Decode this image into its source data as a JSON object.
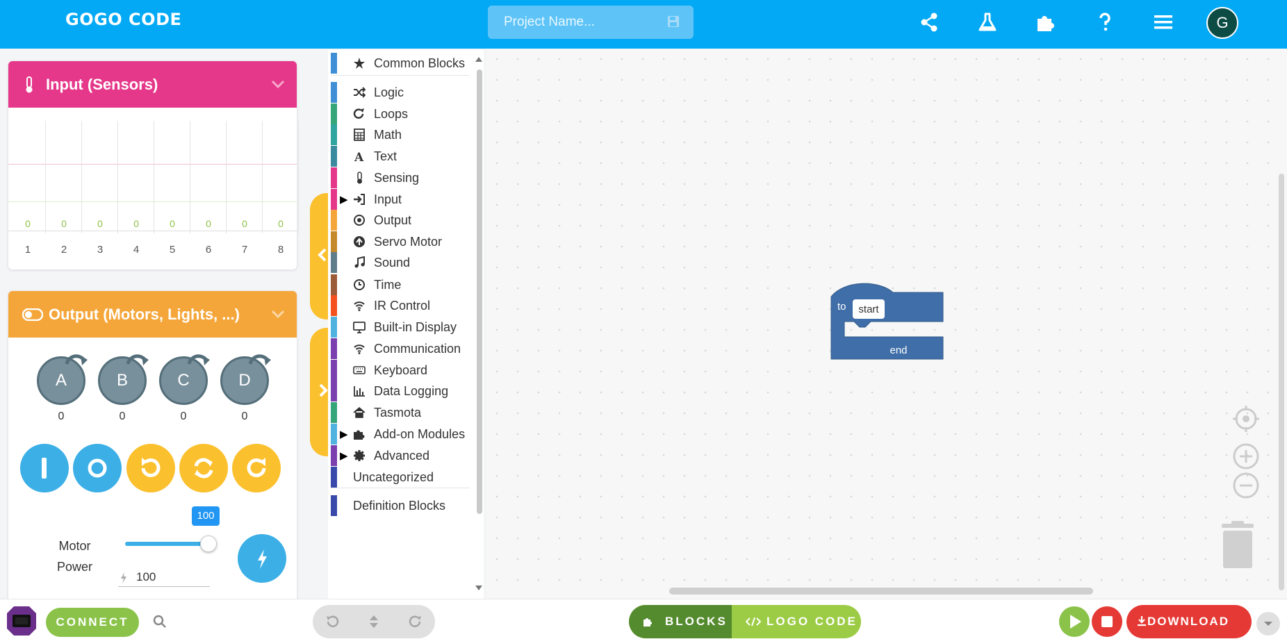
{
  "header": {
    "logo": "GOGO CODE",
    "project_placeholder": "Project Name...",
    "avatar_letter": "G"
  },
  "sensors_panel": {
    "title": "Input (Sensors)",
    "color": "#e5388a",
    "channels": [
      {
        "n": "1",
        "v": "0"
      },
      {
        "n": "2",
        "v": "0"
      },
      {
        "n": "3",
        "v": "0"
      },
      {
        "n": "4",
        "v": "0"
      },
      {
        "n": "5",
        "v": "0"
      },
      {
        "n": "6",
        "v": "0"
      },
      {
        "n": "7",
        "v": "0"
      },
      {
        "n": "8",
        "v": "0"
      }
    ]
  },
  "output_panel": {
    "title": "Output (Motors, Lights, ...)",
    "color": "#f5a63b",
    "motors": [
      {
        "label": "A",
        "value": "0"
      },
      {
        "label": "B",
        "value": "0"
      },
      {
        "label": "C",
        "value": "0"
      },
      {
        "label": "D",
        "value": "0"
      }
    ],
    "motor_power_label_1": "Motor",
    "motor_power_label_2": "Power",
    "power_tooltip": "100",
    "power_value": "100",
    "power_level": 1.0
  },
  "categories": [
    {
      "label": "Common Blocks",
      "color": "#3f8fd6",
      "icon": "star-icon"
    },
    {
      "label": "Logic",
      "color": "#3f8fd6",
      "icon": "shuffle-icon"
    },
    {
      "label": "Loops",
      "color": "#35a57a",
      "icon": "redo-icon"
    },
    {
      "label": "Math",
      "color": "#30a59f",
      "icon": "calculator-icon"
    },
    {
      "label": "Text",
      "color": "#3a8ba0",
      "icon": "font-icon"
    },
    {
      "label": "Sensing",
      "color": "#e5388a",
      "icon": "thermometer-icon"
    },
    {
      "label": "Input",
      "color": "#e5388a",
      "icon": "sign-in-icon"
    },
    {
      "label": "Output",
      "color": "#f5a63b",
      "icon": "dot-circle-icon"
    },
    {
      "label": "Servo Motor",
      "color": "#c4892a",
      "icon": "arrow-circle-up-icon"
    },
    {
      "label": "Sound",
      "color": "#607d8b",
      "icon": "music-icon"
    },
    {
      "label": "Time",
      "color": "#9c5b38",
      "icon": "clock-icon"
    },
    {
      "label": "IR Control",
      "color": "#f4511e",
      "icon": "wifi-icon"
    },
    {
      "label": "Built-in Display",
      "color": "#4fb2df",
      "icon": "desktop-icon"
    },
    {
      "label": "Communication",
      "color": "#7b3fb0",
      "icon": "wifi-icon"
    },
    {
      "label": "Keyboard",
      "color": "#7b3fb0",
      "icon": "keyboard-icon"
    },
    {
      "label": "Data Logging",
      "color": "#7b3fb0",
      "icon": "bar-chart-icon"
    },
    {
      "label": "Tasmota",
      "color": "#35a57a",
      "icon": "home-icon"
    },
    {
      "label": "Add-on Modules",
      "color": "#4fb2df",
      "icon": "puzzle-icon"
    },
    {
      "label": "Advanced",
      "color": "#7b3fb0",
      "icon": "gear-icon"
    },
    {
      "label": "Uncategorized",
      "color": "#3949ab",
      "icon": ""
    },
    {
      "label": "Definition Blocks",
      "color": "#3949ab",
      "icon": ""
    }
  ],
  "block": {
    "keyword": "to",
    "name": "start",
    "end": "end",
    "color": "#3f6ea8"
  },
  "footer": {
    "connect": "CONNECT",
    "blocks_tab": "BLOCKS",
    "logo_tab": "LOGO CODE",
    "download": "DOWNLOAD"
  }
}
